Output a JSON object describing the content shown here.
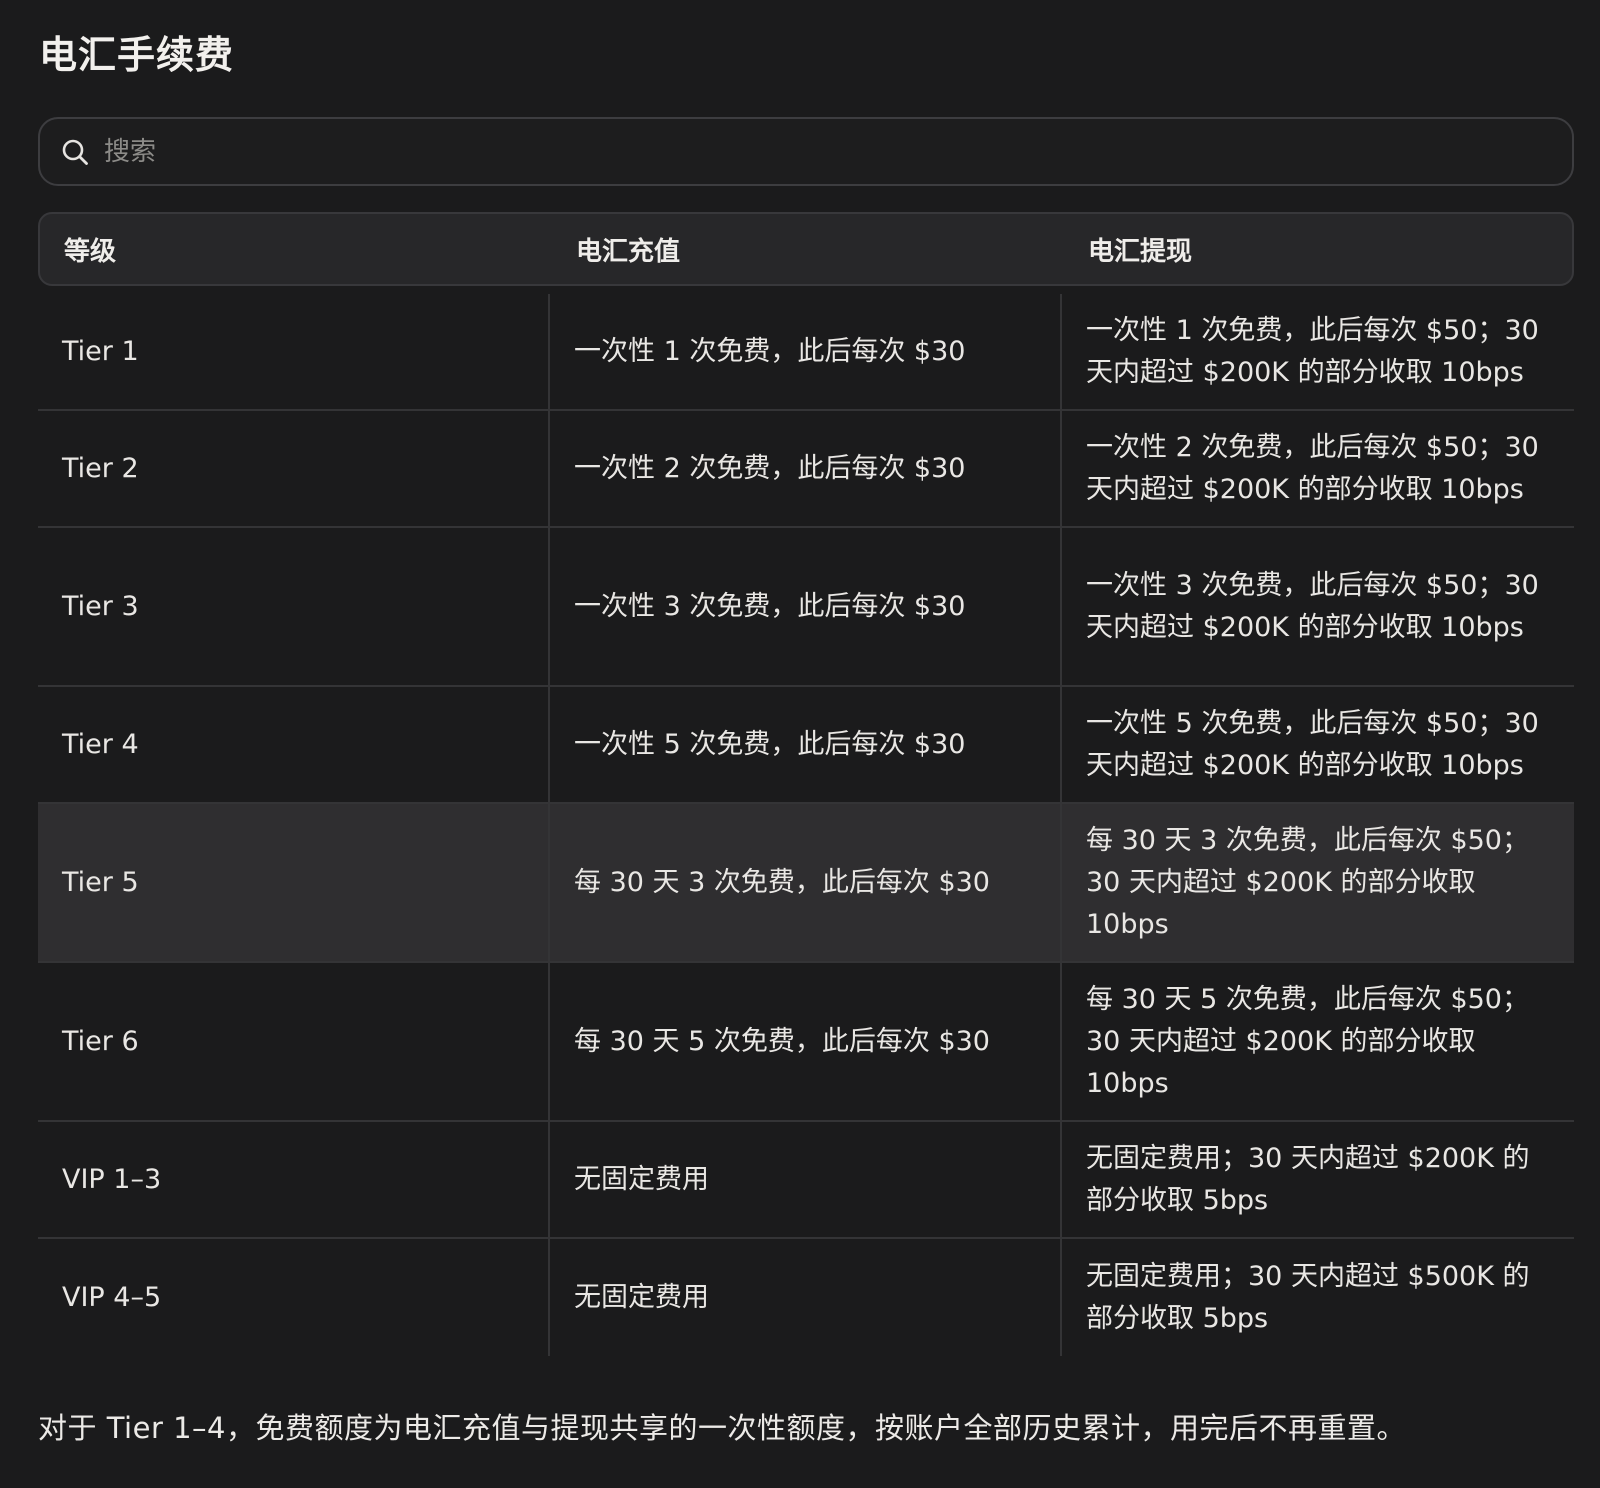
{
  "page_title": "电汇手续费",
  "search": {
    "placeholder": "搜索",
    "value": ""
  },
  "table": {
    "headers": [
      "等级",
      "电汇充值",
      "电汇提现"
    ],
    "rows": [
      {
        "tier": "Tier 1",
        "deposit": "一次性 1 次免费，此后每次 $30",
        "withdraw": "一次性 1 次免费，此后每次 $50；30 天内超过 $200K 的部分收取 10bps"
      },
      {
        "tier": "Tier 2",
        "deposit": "一次性 2 次免费，此后每次 $30",
        "withdraw": "一次性 2 次免费，此后每次 $50；30 天内超过 $200K 的部分收取 10bps"
      },
      {
        "tier": "Tier 3",
        "deposit": "一次性 3 次免费，此后每次 $30",
        "withdraw": "一次性 3 次免费，此后每次 $50；30 天内超过 $200K 的部分收取 10bps"
      },
      {
        "tier": "Tier 4",
        "deposit": "一次性 5 次免费，此后每次 $30",
        "withdraw": "一次性 5 次免费，此后每次 $50；30 天内超过 $200K 的部分收取 10bps"
      },
      {
        "tier": "Tier 5",
        "deposit": "每 30 天 3 次免费，此后每次 $30",
        "withdraw": "每 30 天 3 次免费，此后每次 $50；30 天内超过 $200K 的部分收取 10bps"
      },
      {
        "tier": "Tier 6",
        "deposit": "每 30 天 5 次免费，此后每次 $30",
        "withdraw": "每 30 天 5 次免费，此后每次 $50；30 天内超过 $200K 的部分收取 10bps"
      },
      {
        "tier": "VIP 1–3",
        "deposit": "无固定费用",
        "withdraw": "无固定费用；30 天内超过 $200K 的部分收取 5bps"
      },
      {
        "tier": "VIP 4–5",
        "deposit": "无固定费用",
        "withdraw": "无固定费用；30 天内超过 $500K 的部分收取 5bps"
      }
    ]
  },
  "footnote": "对于 Tier 1–4，免费额度为电汇充值与提现共享的一次性额度，按账户全部历史累计，用完后不再重置。",
  "icons": {
    "search": "search-icon"
  },
  "colors": {
    "background": "#1b1b1c",
    "header_bg": "#272729",
    "highlight_row": "#2f2e30",
    "border": "#343436",
    "text": "#eceae7",
    "placeholder": "#8c8b88"
  }
}
